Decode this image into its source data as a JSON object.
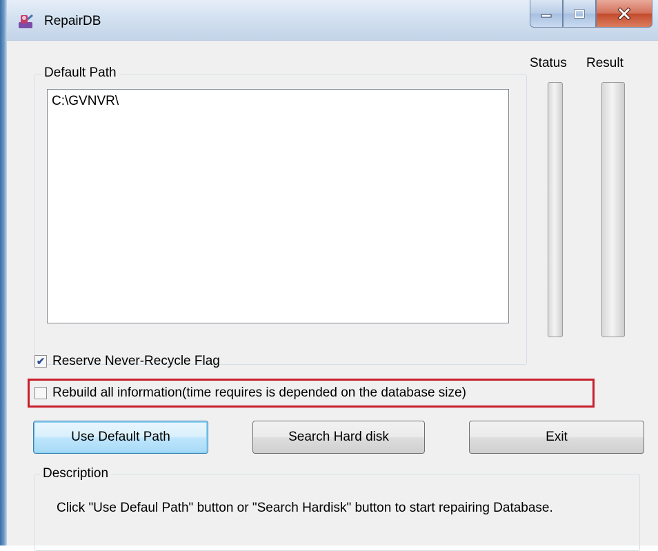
{
  "window": {
    "title": "RepairDB",
    "caption_icons": [
      "minimize-icon",
      "maximize-icon",
      "close-icon"
    ]
  },
  "path_group": {
    "label": "Default Path",
    "items": [
      "C:\\GVNVR\\"
    ]
  },
  "progress": {
    "status_label": "Status",
    "result_label": "Result",
    "status_value": 0,
    "result_value": 0
  },
  "options": {
    "reserve_flag": {
      "label": "Reserve Never-Recycle Flag",
      "checked": true
    },
    "rebuild_all": {
      "label": "Rebuild all information(time requires is depended on the database size)",
      "checked": false
    }
  },
  "buttons": {
    "use_default": "Use Default Path",
    "search": "Search Hard disk",
    "exit": "Exit"
  },
  "description": {
    "label": "Description",
    "text": "Click \"Use Defaul Path\" button or \"Search Hardisk\" button to start repairing Database."
  },
  "colors": {
    "highlight_border": "#c81e2a",
    "progress_fill": "#2c9c2c"
  }
}
